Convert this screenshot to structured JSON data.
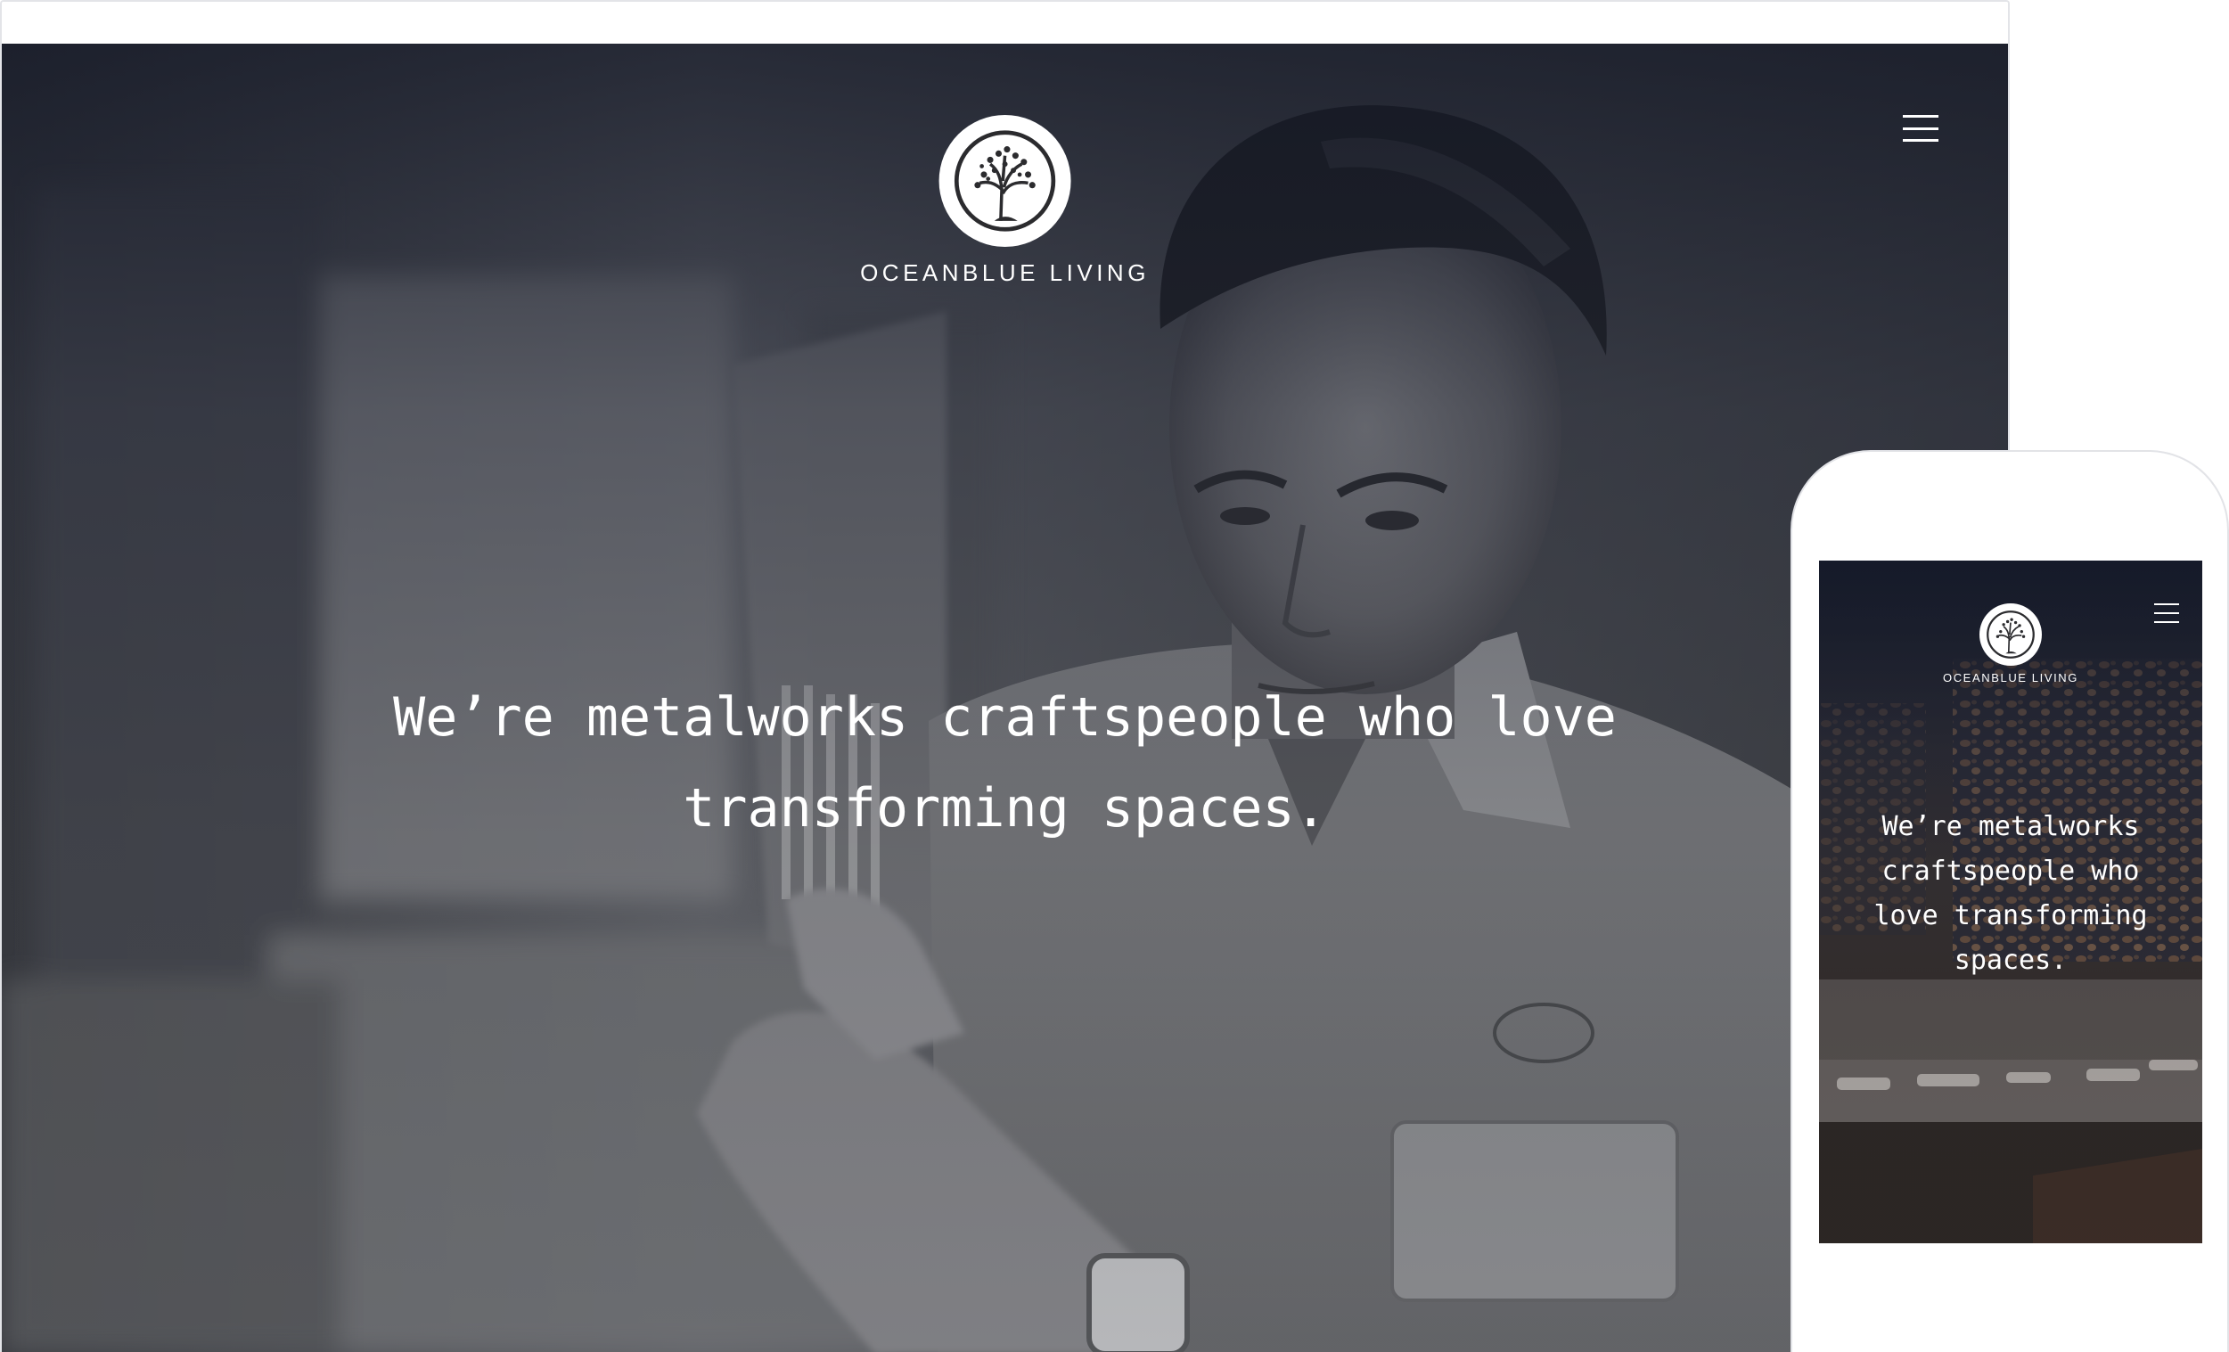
{
  "desktop": {
    "brand": {
      "name": "OCEANBLUE LIVING",
      "logo_icon": "tree-of-life-icon"
    },
    "menu_icon": "hamburger-menu-icon",
    "headline": "We’re metalworks craftspeople who love transforming spaces.",
    "hero_image": "black-and-white photo of a metalworker holding a metal panel"
  },
  "mobile": {
    "brand": {
      "name": "OCEANBLUE LIVING",
      "logo_icon": "tree-of-life-icon"
    },
    "menu_icon": "hamburger-menu-icon",
    "headline": "We’re metalworks craftspeople who love transforming spaces.",
    "hero_image": "laser-cut metal screen casting leaf shadows over an outdoor sofa"
  },
  "colors": {
    "text": "#ffffff",
    "hero_dark": "#1f2536",
    "frame_border": "#e2e3e7"
  }
}
